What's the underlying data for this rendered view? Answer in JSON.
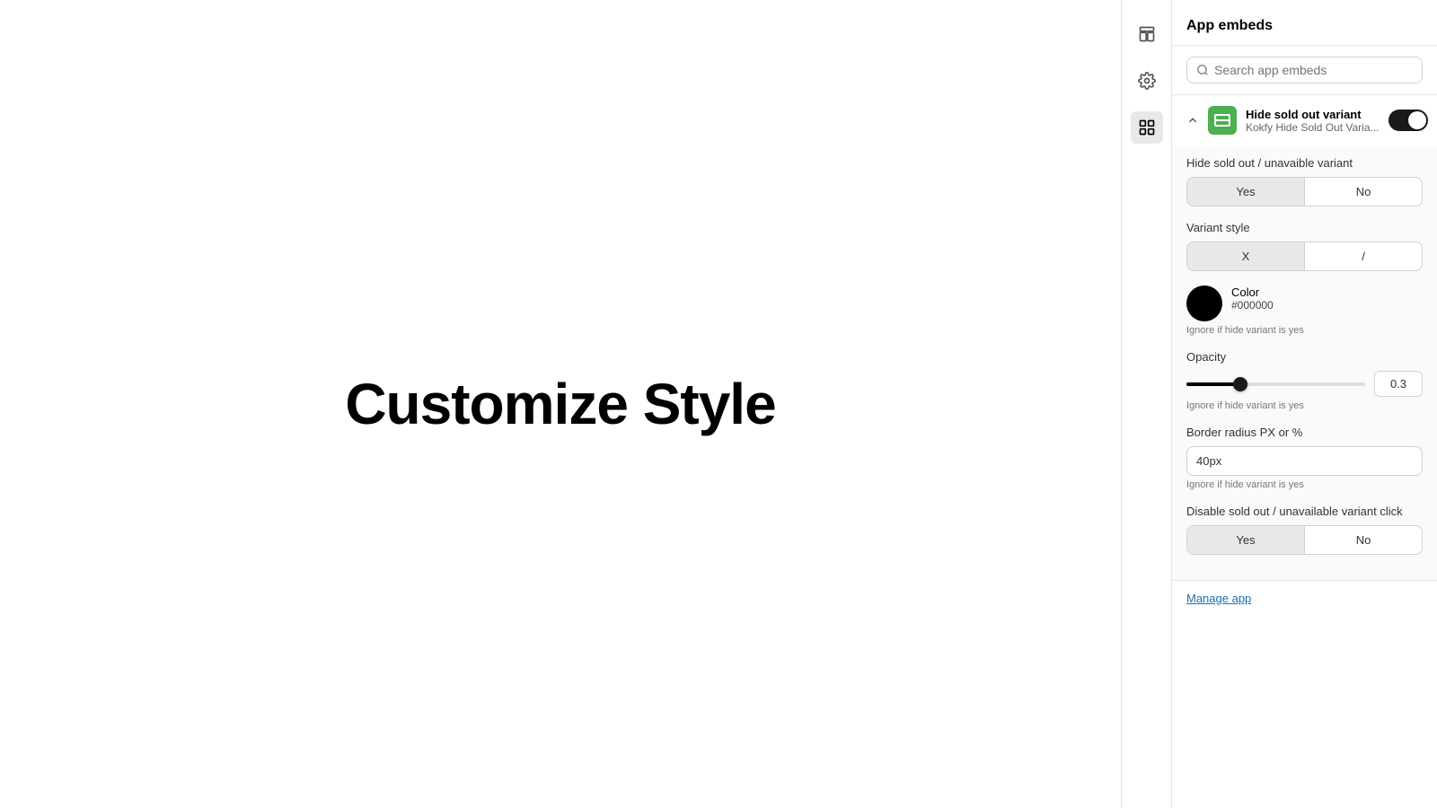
{
  "main": {
    "title": "Customize Style"
  },
  "icon_strip": {
    "icons": [
      {
        "name": "layout-icon",
        "label": "Layout",
        "active": false
      },
      {
        "name": "settings-icon",
        "label": "Settings",
        "active": false
      },
      {
        "name": "apps-icon",
        "label": "Apps",
        "active": true
      }
    ]
  },
  "panel": {
    "title": "App embeds",
    "search_placeholder": "Search app embeds",
    "embed_item": {
      "app_name": "Hide sold out variant",
      "app_subtitle": "Kokfy Hide Sold Out Varia...",
      "toggle_on": true,
      "settings": {
        "hide_variant_label": "Hide sold out / unavaible variant",
        "hide_variant_yes": "Yes",
        "hide_variant_no": "No",
        "hide_variant_selected": "yes",
        "variant_style_label": "Variant style",
        "variant_style_x": "X",
        "variant_style_slash": "/",
        "variant_style_selected": "x",
        "color_label": "Color",
        "color_value": "#000000",
        "color_note": "Ignore if hide variant is yes",
        "opacity_label": "Opacity",
        "opacity_value": "0.3",
        "opacity_note": "Ignore if hide variant is yes",
        "border_radius_label": "Border radius PX or %",
        "border_radius_value": "40px",
        "border_radius_note": "Ignore if hide variant is yes",
        "disable_click_label": "Disable sold out / unavailable variant click",
        "disable_click_yes": "Yes",
        "disable_click_no": "No",
        "disable_click_selected": "yes"
      }
    },
    "manage_app_label": "Manage app"
  }
}
